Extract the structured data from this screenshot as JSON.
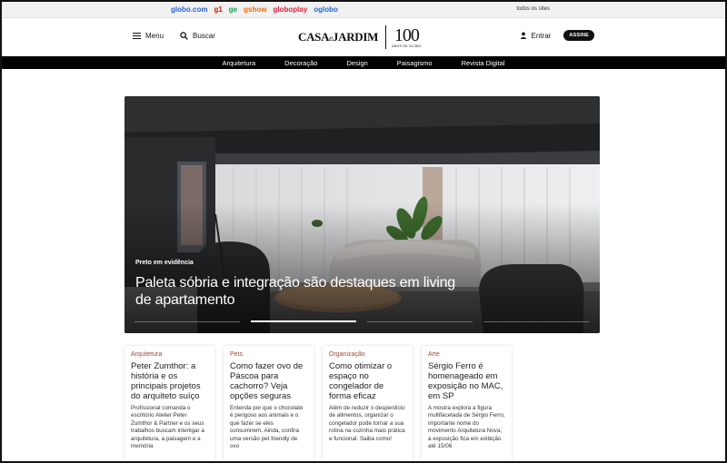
{
  "topbar": {
    "brands": [
      {
        "label": "globo.com",
        "color": "#2a62d6"
      },
      {
        "label": "g1",
        "color": "#c4170c"
      },
      {
        "label": "ge",
        "color": "#06aa48"
      },
      {
        "label": "gshow",
        "color": "#f26a00"
      },
      {
        "label": "globoplay",
        "color": "#d9233f"
      },
      {
        "label": "oglobo",
        "color": "#1d6ad1"
      }
    ],
    "all_sites": "todos os sites"
  },
  "header": {
    "menu_label": "Menu",
    "search_label": "Buscar",
    "logo_casa": "CASA",
    "logo_e": "e",
    "logo_jardim": "JARDIM",
    "logo_100": "100",
    "logo_anos": "ANOS DE GLOBO",
    "login_label": "Entrar",
    "subscribe_label": "ASSINE"
  },
  "nav": {
    "items": [
      "Arquitetura",
      "Decoração",
      "Design",
      "Paisagismo",
      "Revista Digital"
    ]
  },
  "hero": {
    "kicker": "Preto em evidência",
    "headline": "Paleta sóbria e integração são destaques em living de apartamento",
    "slide_count": 4,
    "active_slide": 2
  },
  "cards": [
    {
      "section": "Arquitetura",
      "title": "Peter Zumthor: a história e os principais projetos do arquiteto suíço",
      "summary": "Profissional comanda o escritório Atelier Peter Zumthor & Partner e os seus trabalhos buscam interligar a arquitetura, a paisagem e a memória"
    },
    {
      "section": "Pets",
      "title": "Como fazer ovo de Páscoa para cachorro? Veja opções seguras",
      "summary": "Entenda por que o chocolate é perigoso aos animais e o que fazer se eles consumirem. Ainda, confira uma versão pet friendly de ovo"
    },
    {
      "section": "Organização",
      "title": "Como otimizar o espaço no congelador de forma eficaz",
      "summary": "Além de reduzir o desperdício de alimentos, organizar o congelador pode tornar a sua rotina na cozinha mais prática e funcional. Saiba como!"
    },
    {
      "section": "Arte",
      "title": "Sérgio Ferro é homenageado em exposição no MAC, em SP",
      "summary": "A mostra explora a figura multifacetada de Sérgio Ferro, importante nome do movimento Arquitetura Nova; a exposição fica em exibição até 15/06"
    }
  ]
}
